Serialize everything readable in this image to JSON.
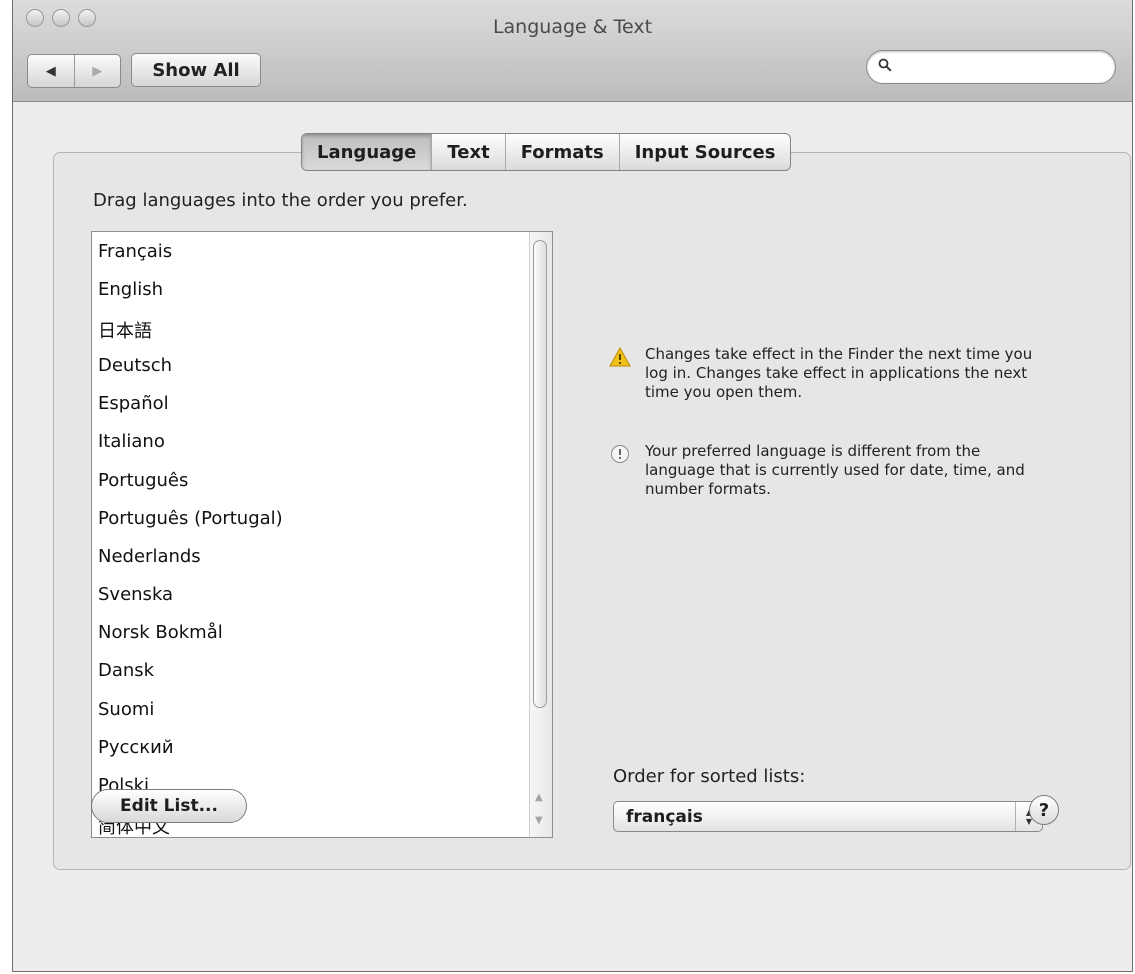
{
  "window": {
    "title": "Language & Text"
  },
  "toolbar": {
    "back_glyph": "◀",
    "forward_glyph": "▶",
    "show_all_label": "Show All",
    "search": {
      "placeholder": "",
      "value": ""
    }
  },
  "tabs": [
    {
      "label": "Language",
      "selected": true
    },
    {
      "label": "Text",
      "selected": false
    },
    {
      "label": "Formats",
      "selected": false
    },
    {
      "label": "Input Sources",
      "selected": false
    }
  ],
  "language_pane": {
    "instructions": "Drag languages into the order you prefer.",
    "languages": [
      "Français",
      "English",
      "日本語",
      "Deutsch",
      "Español",
      "Italiano",
      "Português",
      "Português (Portugal)",
      "Nederlands",
      "Svenska",
      "Norsk Bokmål",
      "Dansk",
      "Suomi",
      "Русский",
      "Polski",
      "简体中文"
    ],
    "notes": [
      {
        "icon": "warning-icon",
        "text": "Changes take effect in the Finder the next time you log in. Changes take effect in applications the next time you open them."
      },
      {
        "icon": "exclamation-circle-icon",
        "text": "Your preferred language is different from the language that is currently used for date, time, and number formats."
      }
    ],
    "order_label": "Order for sorted lists:",
    "order_value": "français",
    "edit_list_label": "Edit List...",
    "help_label": "?"
  },
  "colors": {
    "window_bg": "#ececec",
    "panel_bg": "#e6e6e6",
    "warning": "#f2c21a"
  }
}
